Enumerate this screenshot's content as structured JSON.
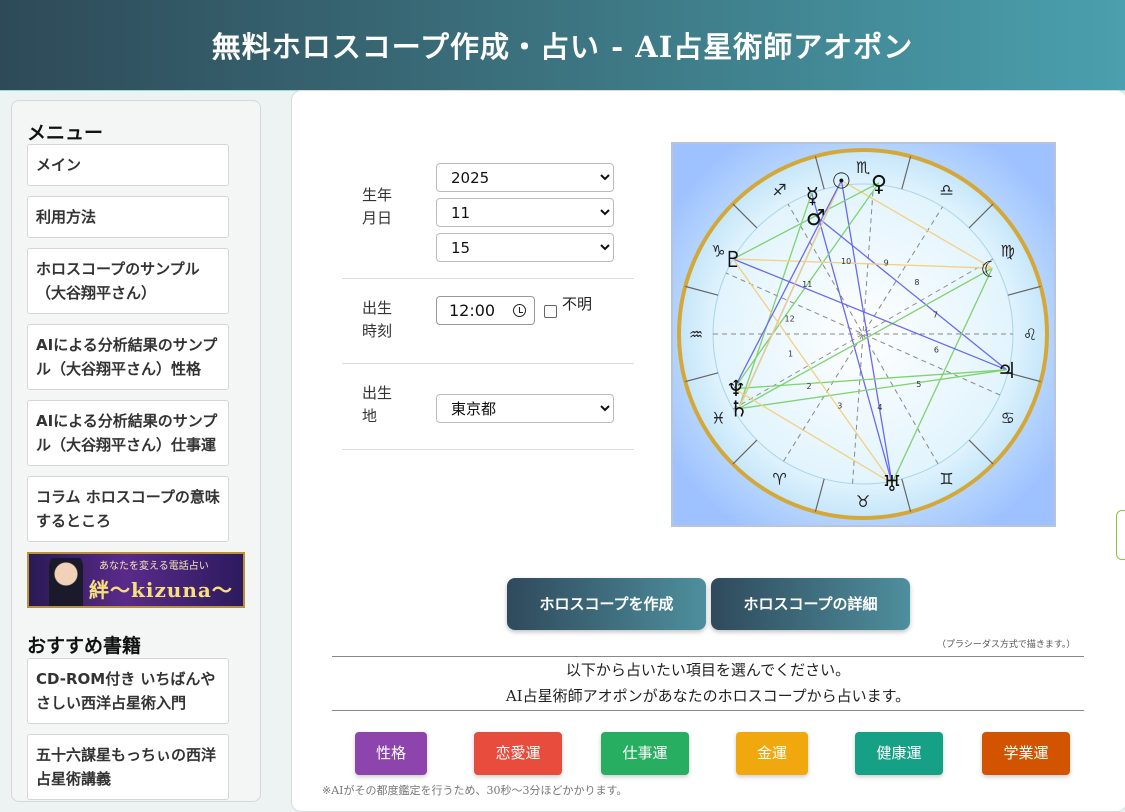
{
  "header": {
    "title": "無料ホロスコープ作成・占い - AI占星術師アオポン"
  },
  "sidebar": {
    "menu_heading": "メニュー",
    "menu_items": [
      "メイン",
      "利用方法",
      "ホロスコープのサンプル（大谷翔平さん）",
      "AIによる分析結果のサンプル（大谷翔平さん）性格",
      "AIによる分析結果のサンプル（大谷翔平さん）仕事運",
      "コラム ホロスコープの意味するところ"
    ],
    "banner": {
      "tagline": "あなたを変える電話占い",
      "name": "絆〜kizuna〜"
    },
    "books_heading": "おすすめ書籍",
    "book_items": [
      "CD-ROM付き いちばんやさしい西洋占星術入門",
      "五十六謀星もっちぃの西洋占星術講義"
    ]
  },
  "form": {
    "birth_date_label": "生年月日",
    "year": "2025",
    "month": "11",
    "day": "15",
    "birth_time_label": "出生時刻",
    "time": "12:00",
    "unknown_label": "不明",
    "birth_place_label": "出生地",
    "place": "東京都"
  },
  "chart": {
    "signs": [
      "♏",
      "♎",
      "♍",
      "♌",
      "♋",
      "♊",
      "♉",
      "♈",
      "♓",
      "♒",
      "♑",
      "♐"
    ],
    "houses": [
      "1",
      "2",
      "3",
      "4",
      "5",
      "6",
      "7",
      "8",
      "9",
      "10",
      "11",
      "12"
    ],
    "planets": {
      "sun": "☉",
      "mercury": "☿",
      "venus": "♀",
      "mars": "♂",
      "moon": "☾",
      "jupiter": "♃",
      "saturn": "♄",
      "uranus": "♅",
      "neptune": "♆",
      "pluto": "♇"
    }
  },
  "actions": {
    "create_label": "ホロスコープを作成",
    "details_label": "ホロスコープの詳細",
    "method_note": "（プラシーダス方式で描きます。）"
  },
  "instructions": {
    "line1": "以下から占いたい項目を選んでください。",
    "line2": "AI占星術師アオポンがあなたのホロスコープから占います。"
  },
  "categories": [
    {
      "label": "性格",
      "color": "#8e44ad"
    },
    {
      "label": "恋愛運",
      "color": "#e74c3c"
    },
    {
      "label": "仕事運",
      "color": "#27ae60"
    },
    {
      "label": "金運",
      "color": "#f1a80f"
    },
    {
      "label": "健康運",
      "color": "#16a085"
    },
    {
      "label": "学業運",
      "color": "#d35400"
    }
  ],
  "footnote": "※AIがその都度鑑定を行うため、30秒〜3分ほどかかります。"
}
